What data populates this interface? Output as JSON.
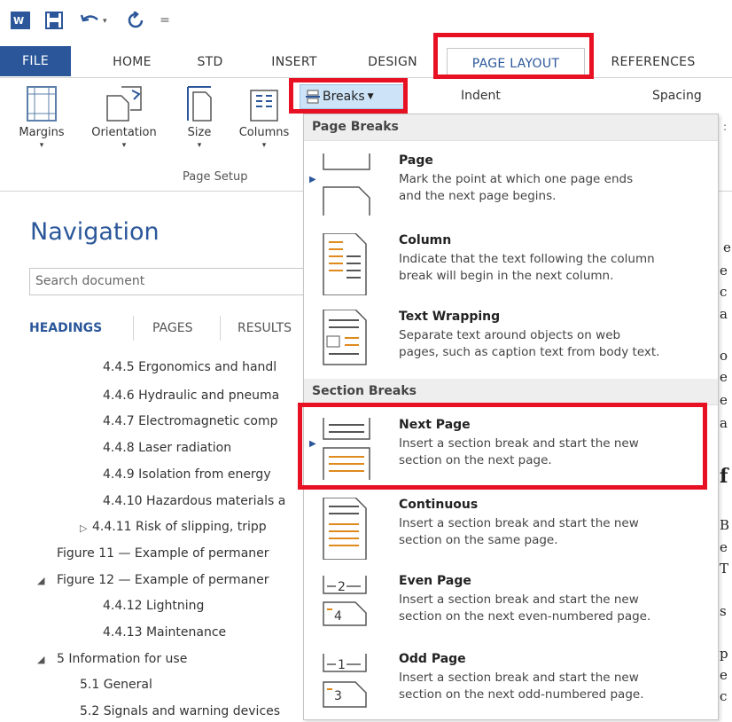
{
  "quick_access": {
    "word_icon": "word-icon",
    "save_icon": "save-icon",
    "undo_icon": "undo-icon",
    "redo_icon": "redo-icon",
    "customize_icon": "customize-qat-icon"
  },
  "tabs": {
    "file": "FILE",
    "home": "HOME",
    "std": "STD",
    "insert": "INSERT",
    "design": "DESIGN",
    "page_layout": "PAGE LAYOUT",
    "references": "REFERENCES"
  },
  "ribbon": {
    "margins": "Margins",
    "orientation": "Orientation",
    "size": "Size",
    "columns": "Columns",
    "breaks": "Breaks",
    "indent": "Indent",
    "spacing": "Spacing",
    "group_page_setup": "Page Setup"
  },
  "navigation": {
    "title": "Navigation",
    "search_placeholder": "Search document",
    "tab_headings": "HEADINGS",
    "tab_pages": "PAGES",
    "tab_results": "RESULTS",
    "items": [
      "4.4.5 Ergonomics and handl",
      "4.4.6 Hydraulic and pneuma",
      "4.4.7 Electromagnetic comp",
      "4.4.8 Laser radiation",
      "4.4.9 Isolation from energy",
      "4.4.10 Hazardous materials a",
      "4.4.11 Risk of slipping, tripp",
      "Figure 11 — Example of permaner",
      "Figure 12 — Example of permaner",
      "4.4.12 Lightning",
      "4.4.13 Maintenance",
      "5 Information for use",
      "5.1 General",
      "5.2 Signals and warning devices"
    ]
  },
  "breaks_menu": {
    "section_page_breaks": "Page Breaks",
    "section_section_breaks": "Section Breaks",
    "items": [
      {
        "title": "Page",
        "desc1": "Mark the point at which one page ends",
        "desc2": "and the next page begins."
      },
      {
        "title": "Column",
        "desc1": "Indicate that the text following the column",
        "desc2": "break will begin in the next column."
      },
      {
        "title": "Text Wrapping",
        "desc1": "Separate text around objects on web",
        "desc2": "pages, such as caption text from body text."
      },
      {
        "title": "Next Page",
        "desc1": "Insert a section break and start the new",
        "desc2": "section on the next page."
      },
      {
        "title": "Continuous",
        "desc1": "Insert a section break and start the new",
        "desc2": "section on the same page."
      },
      {
        "title": "Even Page",
        "desc1": "Insert a section break and start the new",
        "desc2": "section on the next even-numbered page."
      },
      {
        "title": "Odd Page",
        "desc1": "Insert a section break and start the new",
        "desc2": "section on the next odd-numbered page."
      }
    ]
  },
  "doc_peek": [
    "e",
    "e",
    "c",
    "a",
    "o",
    "e",
    "e",
    "a",
    "f",
    "B",
    "e",
    "T",
    "s",
    "p",
    "e",
    "c"
  ],
  "colors": {
    "accent": "#2b579a",
    "highlight": "#e81123",
    "breaks_button": "#cde3f7"
  }
}
